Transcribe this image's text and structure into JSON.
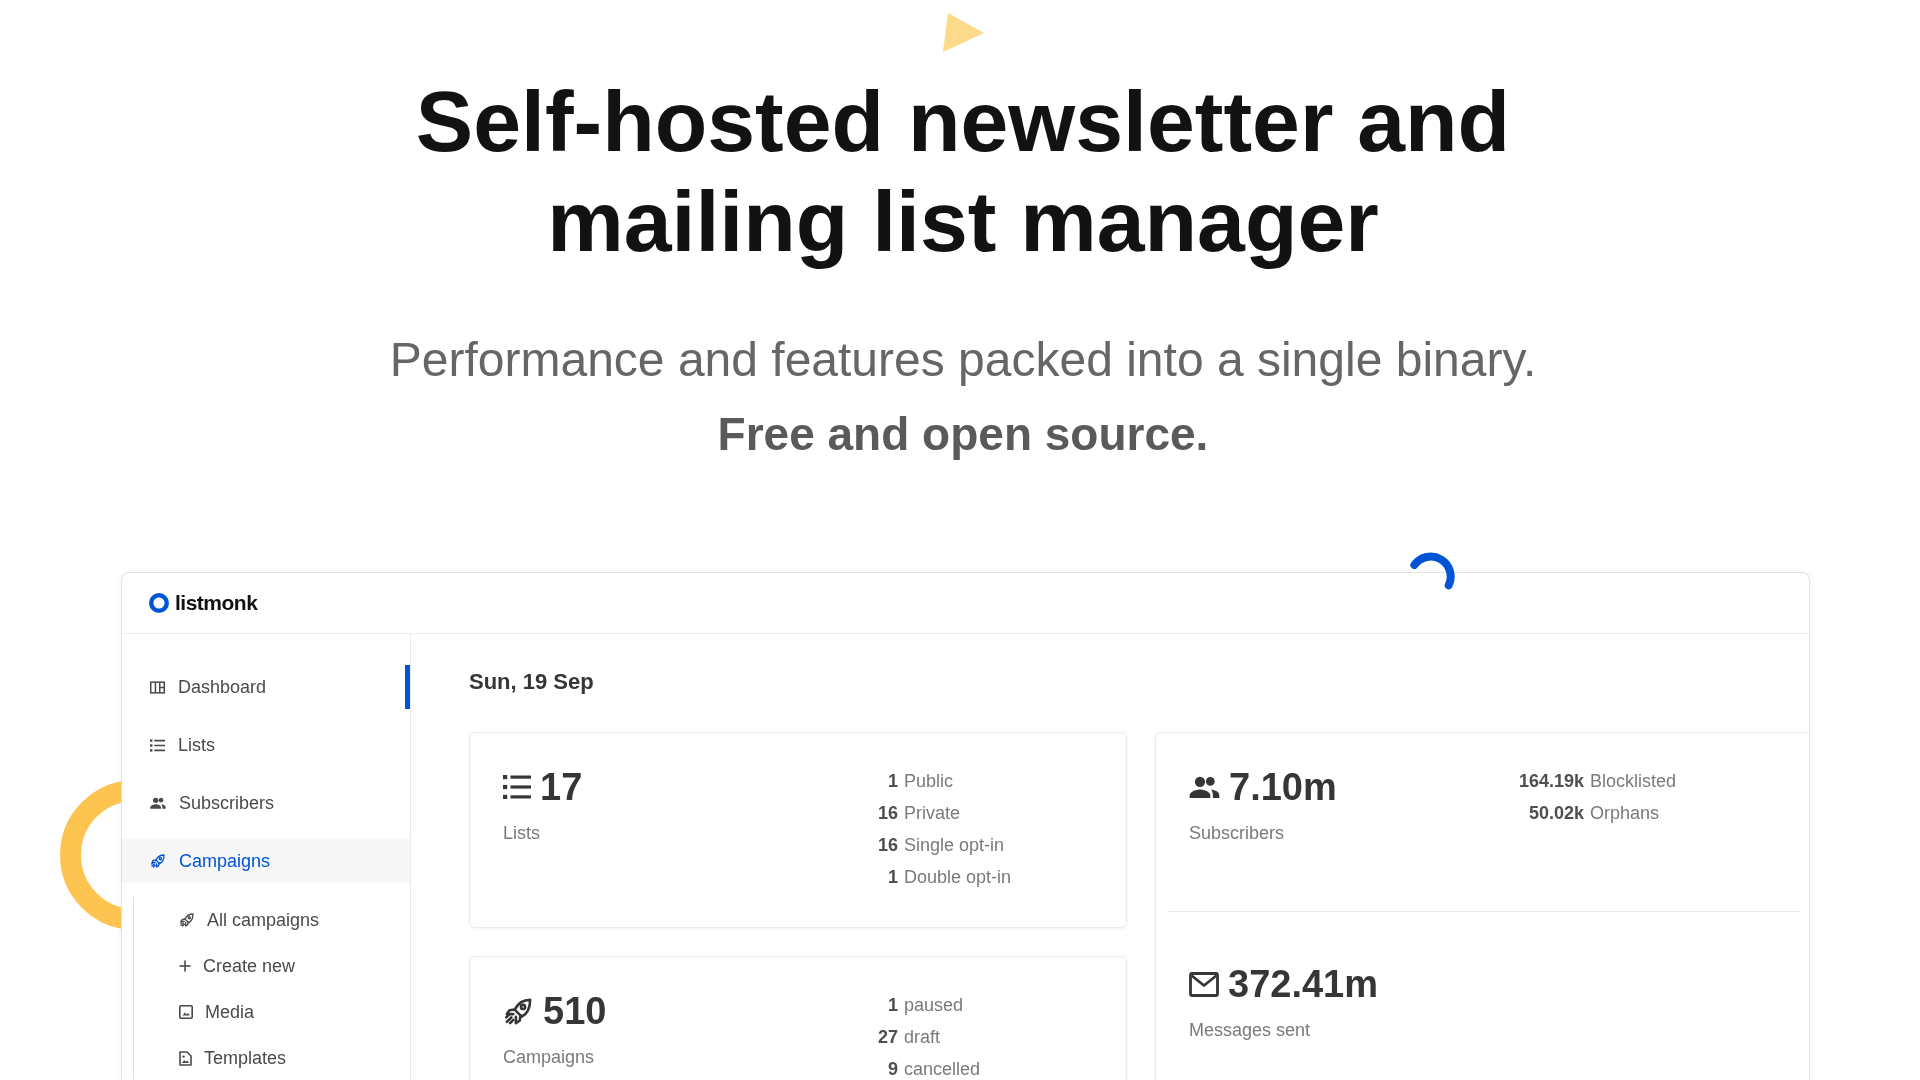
{
  "hero": {
    "title": "Self-hosted newsletter and mailing list manager",
    "subtitle": "Performance and features packed into a single binary.",
    "tagline": "Free and open source."
  },
  "app": {
    "logo": "listmonk",
    "sidebar": {
      "items": [
        {
          "label": "Dashboard",
          "selected": true,
          "expanded": false
        },
        {
          "label": "Lists",
          "selected": false,
          "expanded": false
        },
        {
          "label": "Subscribers",
          "selected": false,
          "expanded": false
        },
        {
          "label": "Campaigns",
          "selected": false,
          "expanded": true,
          "children": [
            {
              "label": "All campaigns",
              "selected": false
            },
            {
              "label": "Create new",
              "selected": false
            },
            {
              "label": "Media",
              "selected": false
            },
            {
              "label": "Templates",
              "selected": false
            }
          ]
        }
      ]
    },
    "date": "Sun, 19 Sep",
    "cards": [
      {
        "sections": [
          {
            "value": "17",
            "label": "Lists",
            "stats": [
              {
                "count": "1",
                "label": "Public"
              },
              {
                "count": "16",
                "label": "Private"
              },
              {
                "count": "16",
                "label": "Single opt-in"
              },
              {
                "count": "1",
                "label": "Double opt-in"
              }
            ]
          }
        ]
      },
      {
        "sections": [
          {
            "value": "7.10m",
            "label": "Subscribers",
            "stats": [
              {
                "count": "164.19k",
                "label": "Blocklisted"
              },
              {
                "count": "50.02k",
                "label": "Orphans"
              }
            ]
          },
          {
            "value": "372.41m",
            "label": "Messages sent"
          }
        ]
      },
      {
        "sections": [
          {
            "value": "510",
            "label": "Campaigns",
            "stats": [
              {
                "count": "1",
                "label": "paused"
              },
              {
                "count": "27",
                "label": "draft"
              },
              {
                "count": "9",
                "label": "cancelled"
              }
            ]
          }
        ]
      }
    ]
  }
}
